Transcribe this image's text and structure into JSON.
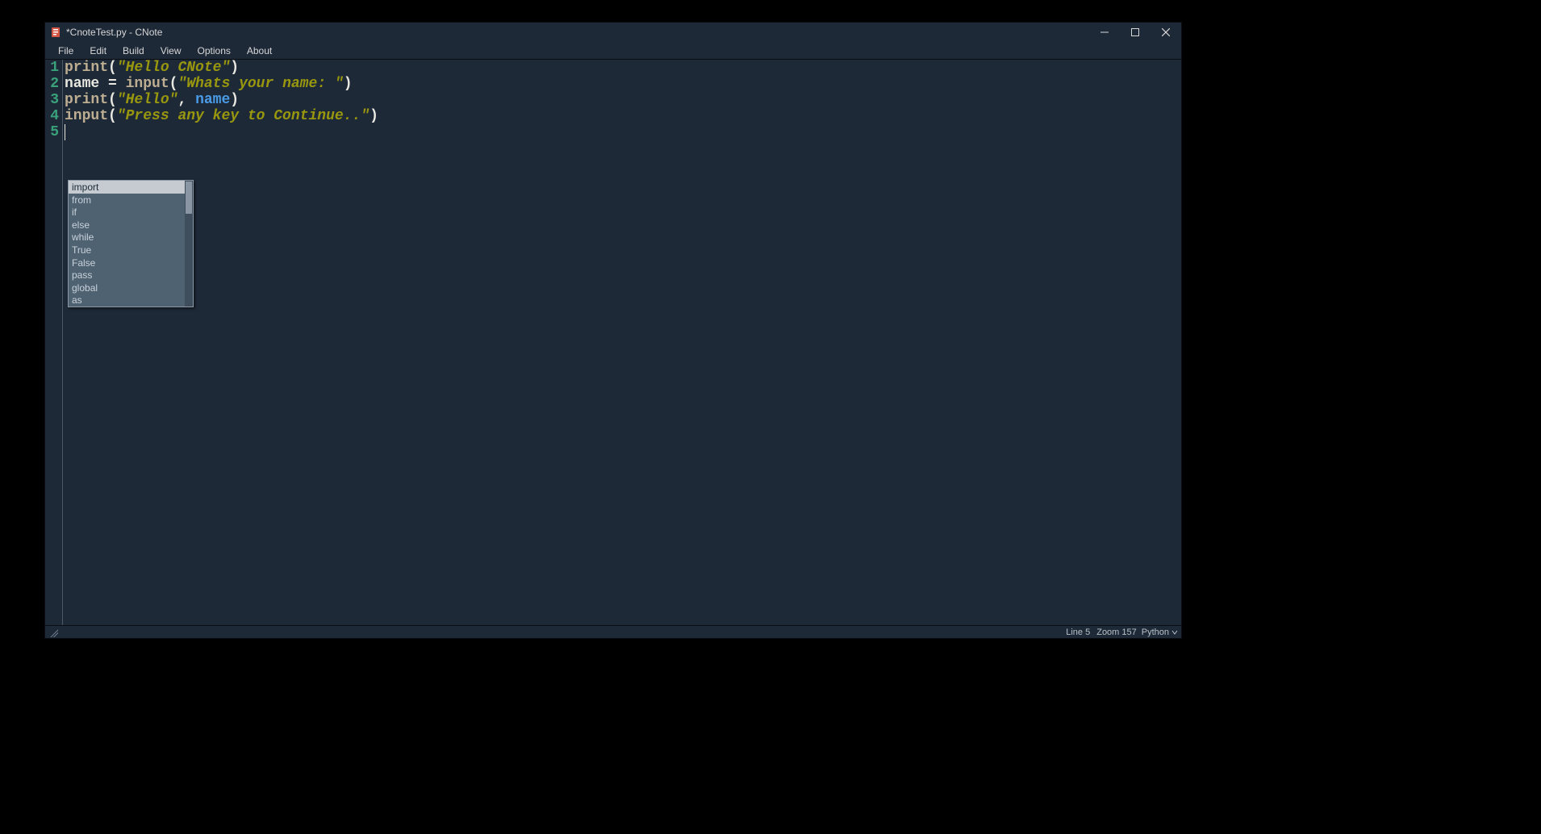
{
  "window": {
    "title": "*CnoteTest.py - CNote"
  },
  "menu": {
    "items": [
      "File",
      "Edit",
      "Build",
      "View",
      "Options",
      "About"
    ]
  },
  "editor": {
    "line_numbers": [
      "1",
      "2",
      "3",
      "4",
      "5"
    ],
    "lines": [
      [
        {
          "cls": "tok-fn",
          "t": "print"
        },
        {
          "cls": "tok-op",
          "t": "("
        },
        {
          "cls": "tok-str",
          "t": "\"Hello CNote\""
        },
        {
          "cls": "tok-op",
          "t": ")"
        }
      ],
      [
        {
          "cls": "tok-id",
          "t": "name "
        },
        {
          "cls": "tok-op",
          "t": "= "
        },
        {
          "cls": "tok-fn",
          "t": "input"
        },
        {
          "cls": "tok-op",
          "t": "("
        },
        {
          "cls": "tok-str",
          "t": "\"Whats your name: \""
        },
        {
          "cls": "tok-op",
          "t": ")"
        }
      ],
      [
        {
          "cls": "tok-fn",
          "t": "print"
        },
        {
          "cls": "tok-op",
          "t": "("
        },
        {
          "cls": "tok-str",
          "t": "\"Hello\""
        },
        {
          "cls": "tok-op",
          "t": ", "
        },
        {
          "cls": "tok-arg",
          "t": "name"
        },
        {
          "cls": "tok-op",
          "t": ")"
        }
      ],
      [
        {
          "cls": "tok-fn",
          "t": "input"
        },
        {
          "cls": "tok-op",
          "t": "("
        },
        {
          "cls": "tok-str",
          "t": "\"Press any key to Continue..\""
        },
        {
          "cls": "tok-op",
          "t": ")"
        }
      ],
      []
    ]
  },
  "autocomplete": {
    "items": [
      "import",
      "from",
      "if",
      "else",
      "while",
      "True",
      "False",
      "pass",
      "global",
      "as"
    ],
    "selected_index": 0
  },
  "status": {
    "line_info": "Line 5",
    "zoom_info": "Zoom 157",
    "language": "Python"
  }
}
